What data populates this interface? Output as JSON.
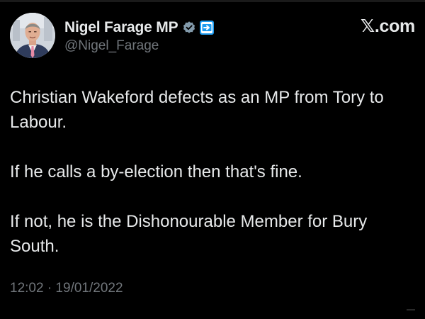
{
  "post": {
    "author": {
      "display_name": "Nigel Farage MP",
      "handle": "@Nigel_Farage",
      "verified_badge_icon": "verified-badge-icon",
      "affiliation_badge_icon": "affiliation-badge-icon",
      "avatar_icon": "avatar"
    },
    "site_label": "𝕏.com",
    "text_paragraphs": [
      "Christian Wakeford defects as an MP from Tory to Labour.",
      "If he calls a by-election then that's fine.",
      "If not, he is the Dishonourable Member for Bury South."
    ],
    "timestamp": "12:02 · 19/01/2022"
  },
  "colors": {
    "background": "#000000",
    "primary_text": "#e7e9ea",
    "secondary_text": "#71767b",
    "verified_badge": "#829aab",
    "affiliation_badge": "#1d9bf0"
  }
}
